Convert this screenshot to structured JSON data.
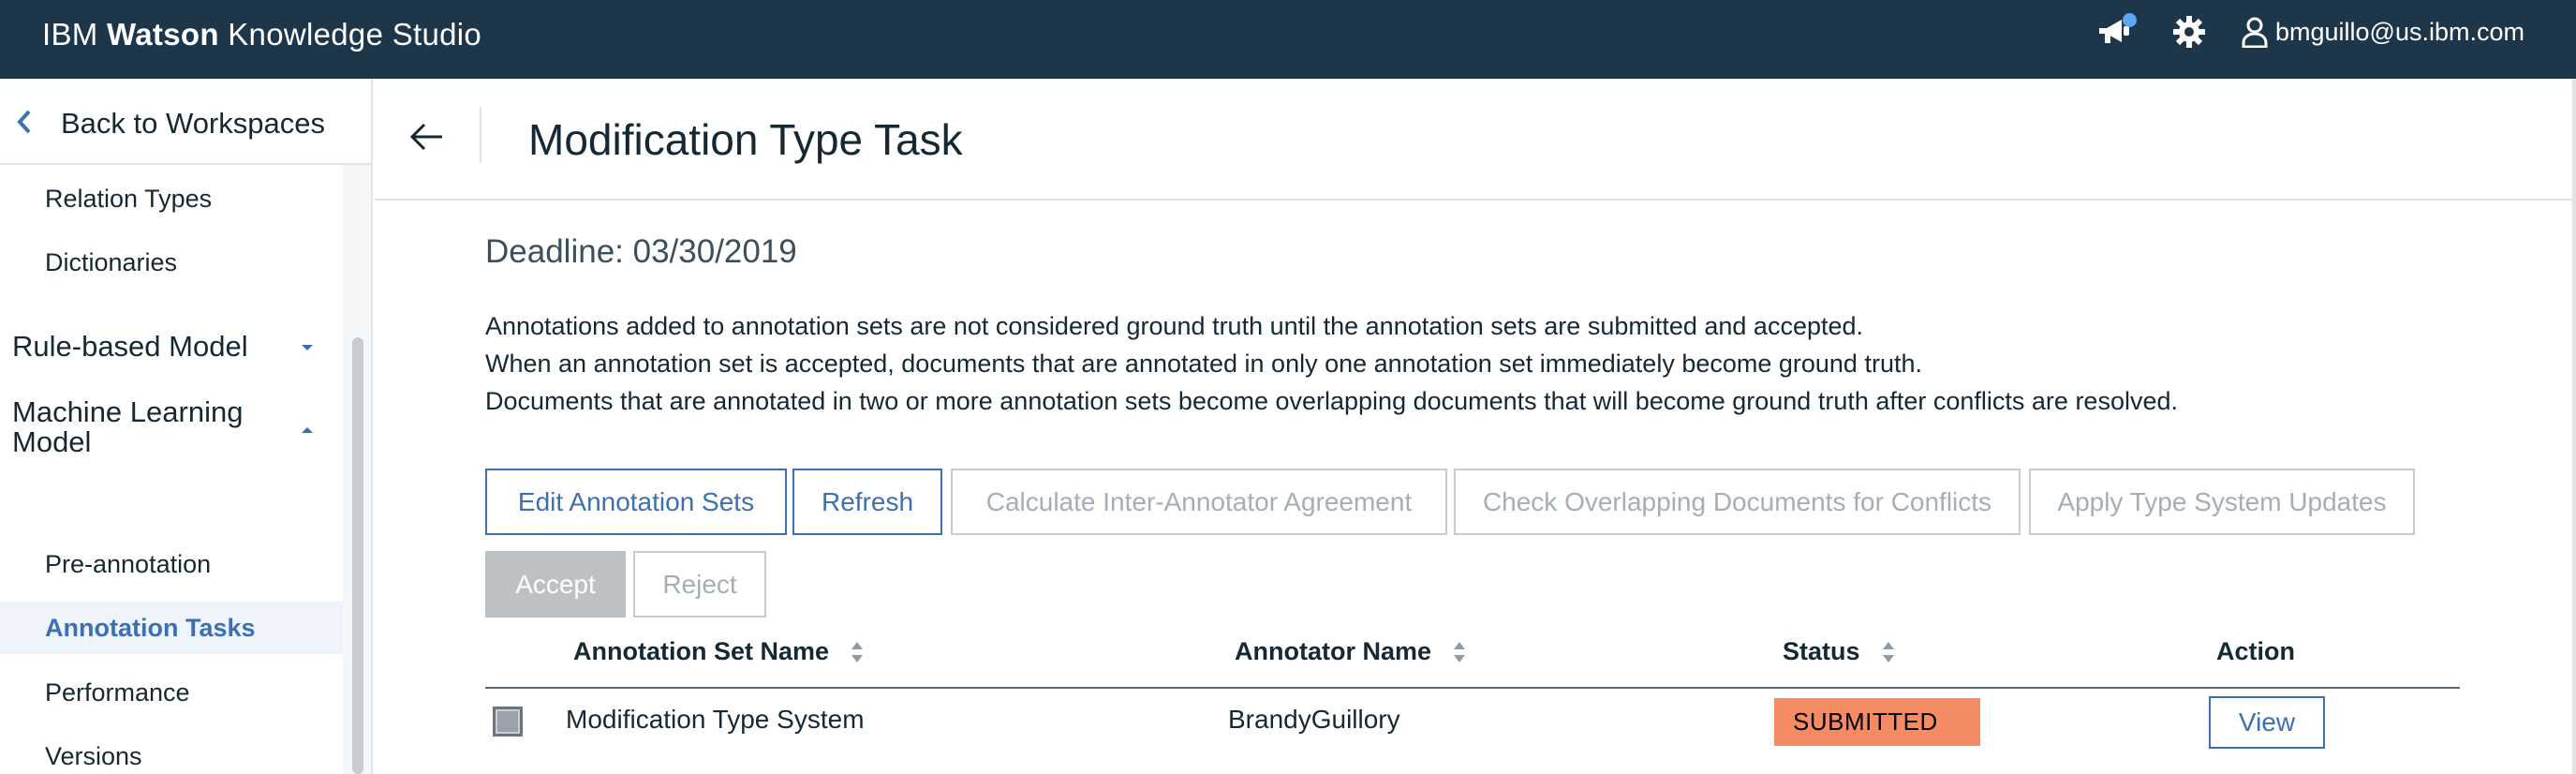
{
  "header": {
    "brand_prefix": "IBM",
    "brand_bold": "Watson",
    "brand_suffix": "Knowledge Studio",
    "user_email": "bmguillo@us.ibm.com",
    "icons": [
      "megaphone-icon",
      "gear-icon",
      "user-icon"
    ]
  },
  "sidebar": {
    "back_label": "Back to Workspaces",
    "items": [
      {
        "label": "Relation Types"
      },
      {
        "label": "Dictionaries"
      },
      {
        "label": "Rule-based Model"
      },
      {
        "label": "Machine Learning Model"
      },
      {
        "label": "Pre-annotation"
      },
      {
        "label": "Annotation Tasks"
      },
      {
        "label": "Performance"
      },
      {
        "label": "Versions"
      }
    ],
    "active_item": "Annotation Tasks"
  },
  "main": {
    "title": "Modification Type Task",
    "deadline": "Deadline: 03/30/2019",
    "description": [
      "Annotations added to annotation sets are not considered ground truth until the annotation sets are submitted and accepted.",
      "When an annotation set is accepted, documents that are annotated in only one annotation set immediately become ground truth.",
      "Documents that are annotated in two or more annotation sets become overlapping documents that will become ground truth after conflicts are resolved."
    ],
    "buttons": {
      "edit_sets": "Edit Annotation Sets",
      "refresh": "Refresh",
      "calc_iaa": "Calculate Inter-Annotator Agreement",
      "check_overlap": "Check Overlapping Documents for Conflicts",
      "apply_type": "Apply Type System Updates",
      "accept": "Accept",
      "reject": "Reject"
    },
    "table": {
      "columns": [
        "Annotation Set Name",
        "Annotator Name",
        "Status",
        "Action"
      ],
      "rows": [
        {
          "set_name": "Modification Type System",
          "annotator": "BrandyGuillory",
          "status": "SUBMITTED",
          "action": "View"
        }
      ]
    }
  },
  "colors": {
    "topbar": "#1d3649",
    "accent": "#3d70b2",
    "status_submitted": "#f58b62",
    "active_bg": "#eef4fa"
  }
}
